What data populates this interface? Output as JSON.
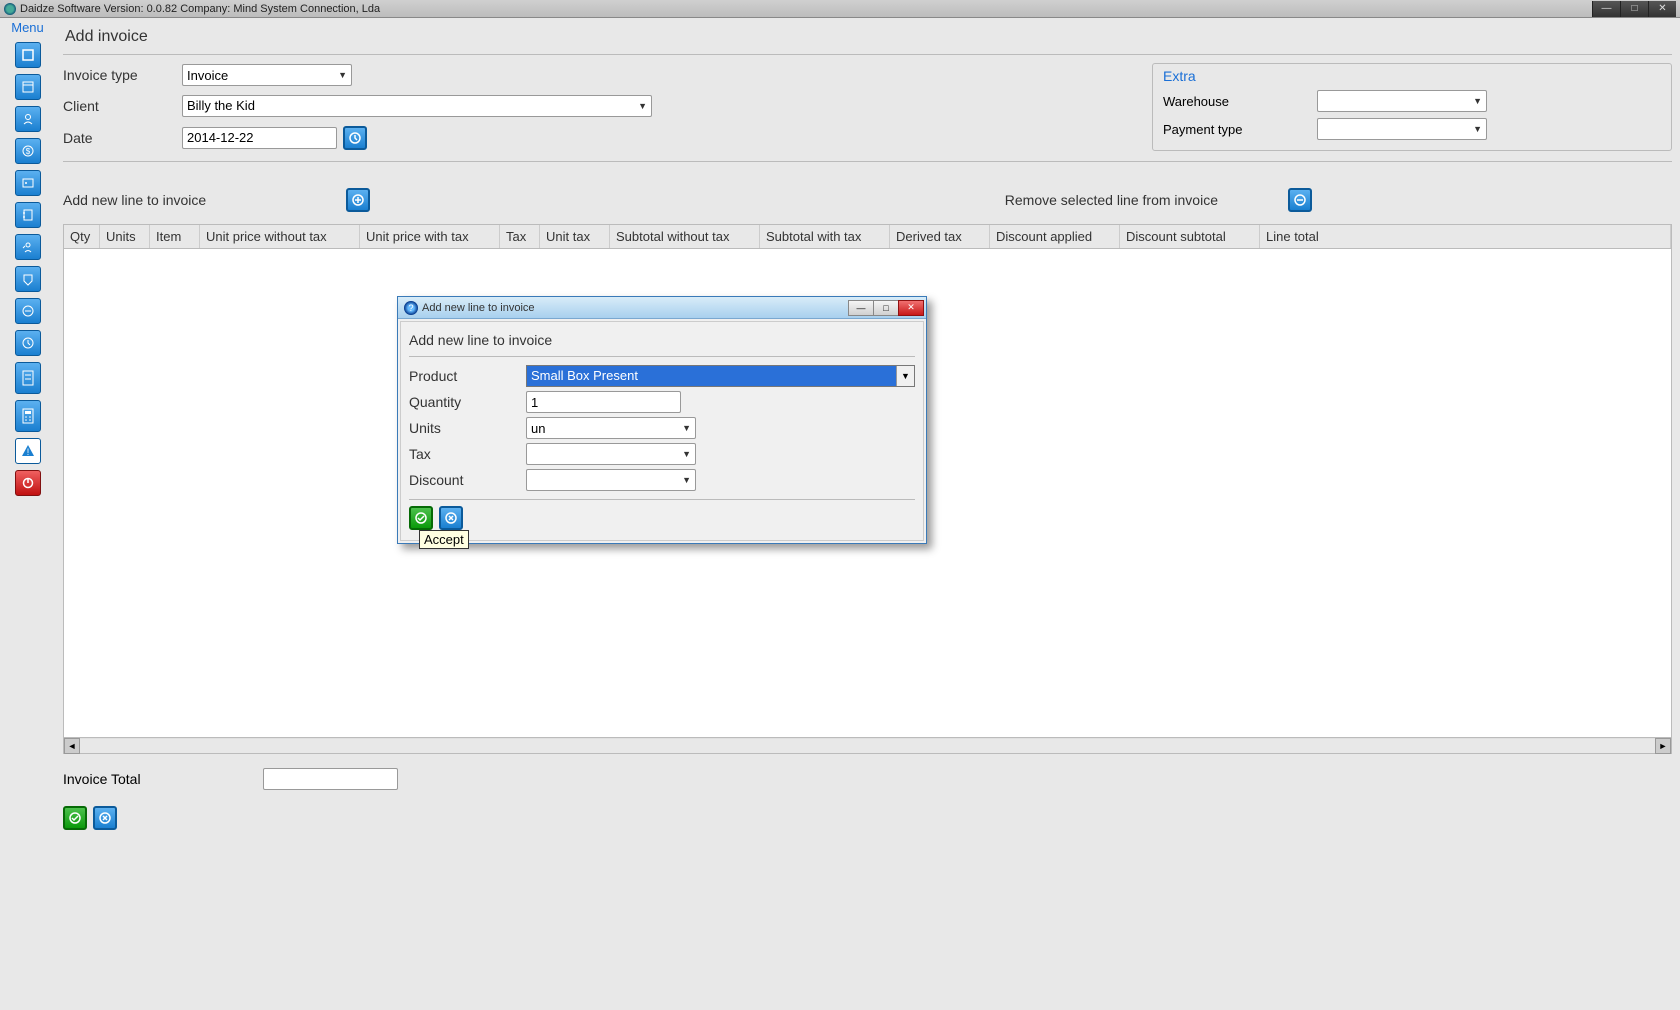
{
  "titlebar": "Daidze Software Version: 0.0.82 Company: Mind System Connection, Lda",
  "sidebar": {
    "menu_label": "Menu"
  },
  "page": {
    "title": "Add invoice",
    "invoice_type_label": "Invoice type",
    "invoice_type_value": "Invoice",
    "client_label": "Client",
    "client_value": "Billy the Kid",
    "date_label": "Date",
    "date_value": "2014-12-22",
    "extra_title": "Extra",
    "warehouse_label": "Warehouse",
    "warehouse_value": "",
    "payment_type_label": "Payment type",
    "payment_type_value": "",
    "add_line_label": "Add new line to invoice",
    "remove_line_label": "Remove selected line from invoice",
    "invoice_total_label": "Invoice Total",
    "invoice_total_value": ""
  },
  "table": {
    "columns": [
      "Qty",
      "Units",
      "Item",
      "Unit price without tax",
      "Unit price with tax",
      "Tax",
      "Unit tax",
      "Subtotal without tax",
      "Subtotal with tax",
      "Derived tax",
      "Discount applied",
      "Discount subtotal",
      "Line total"
    ]
  },
  "dialog": {
    "title": "Add new line to invoice",
    "heading": "Add new line to invoice",
    "product_label": "Product",
    "product_value": "Small Box Present",
    "quantity_label": "Quantity",
    "quantity_value": "1",
    "units_label": "Units",
    "units_value": "un",
    "tax_label": "Tax",
    "tax_value": "",
    "discount_label": "Discount",
    "discount_value": "",
    "tooltip": "Accept"
  }
}
